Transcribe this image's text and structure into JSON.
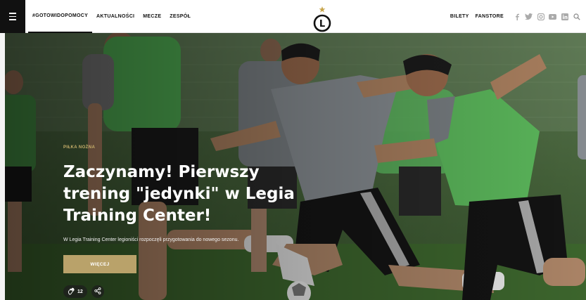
{
  "nav": {
    "left": [
      "#GOTOWIDOPOMOCY",
      "AKTUALNOŚCI",
      "MECZE",
      "ZESPÓŁ"
    ],
    "right": [
      "BILETY",
      "FANSTORE"
    ],
    "social_icons": [
      "facebook-icon",
      "twitter-icon",
      "instagram-icon",
      "youtube-icon",
      "linkedin-icon"
    ]
  },
  "logo": {
    "letter": "L"
  },
  "hero": {
    "category": "PIŁKA NOŻNA",
    "headline": "Zaczynamy! Pierwszy trening \"jedynki\" w Legia Training Center!",
    "lead": "W Legia Training Center legioniści rozpoczęli przygotowania do nowego sezonu.",
    "button": "WIĘCEJ",
    "likes": "12"
  },
  "colors": {
    "accent": "#b9a26a",
    "pitch": "#4f7a3c",
    "bib": "#58c45c"
  }
}
